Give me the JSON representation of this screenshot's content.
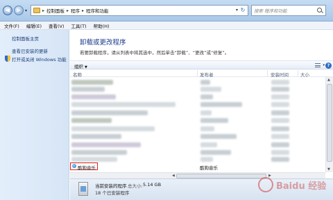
{
  "address_bar": {
    "crumbs": [
      "控制面板",
      "程序",
      "程序和功能"
    ]
  },
  "search": {
    "placeholder": "搜索 程序和功能"
  },
  "menu": [
    "文件(F)",
    "编辑(E)",
    "查看(V)",
    "工具(T)",
    "帮助(H)"
  ],
  "sidebar": {
    "home": "控制面板主页",
    "updates": "查看已安装的更新",
    "features": "打开或关闭 Windows 功能"
  },
  "main": {
    "title": "卸载或更改程序",
    "description": "若要卸载程序，请从列表中将其选中，然后单击“卸载”、“更改”或“修复”。"
  },
  "toolbar": {
    "organize": "组织"
  },
  "columns": [
    "名称",
    "发布者",
    "安装时间",
    "大小"
  ],
  "selected_program": {
    "name": "酷狗音乐",
    "publisher": "酷狗音乐"
  },
  "details": {
    "title": "当前安装的程序",
    "size_label": "总大小:",
    "size": "5.14 GB",
    "count": "18 个已安装程序"
  },
  "watermark": "Baidu 经验"
}
